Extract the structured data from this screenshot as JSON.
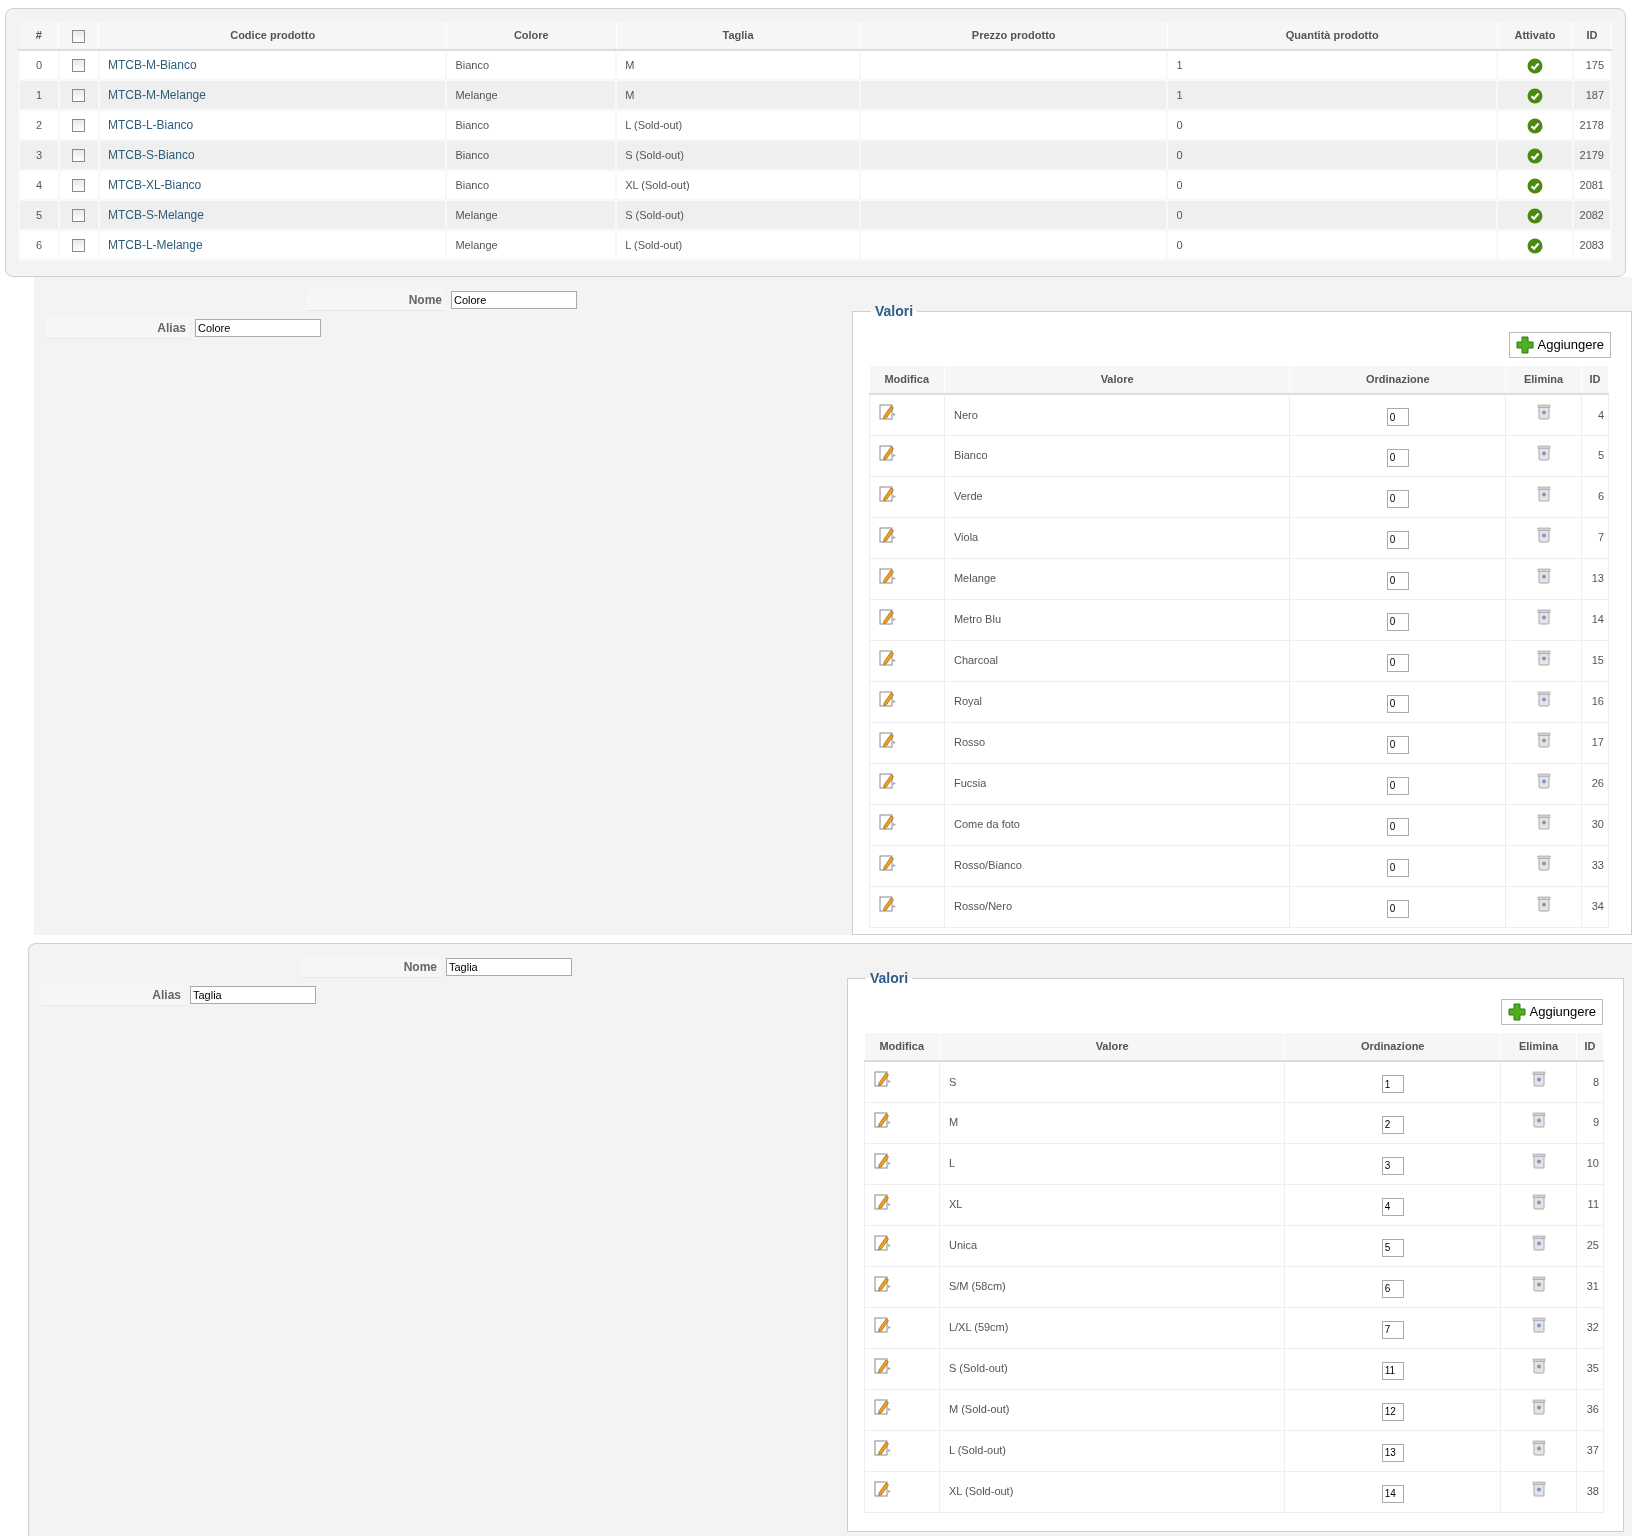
{
  "products": {
    "columns": [
      "#",
      "Codice prodotto",
      "Colore",
      "Taglia",
      "Prezzo prodotto",
      "Quantità prodotto",
      "Attivato",
      "ID"
    ],
    "select_all_checked": false,
    "rows": [
      {
        "index": "0",
        "checked": false,
        "code": "MTCB-M-Bianco",
        "colore": "Bianco",
        "size": "M",
        "qty": "1",
        "active": true,
        "id": "175"
      },
      {
        "index": "1",
        "checked": false,
        "code": "MTCB-M-Melange",
        "colore": "Melange",
        "size": "M",
        "qty": "1",
        "active": true,
        "id": "187"
      },
      {
        "index": "2",
        "checked": false,
        "code": "MTCB-L-Bianco",
        "colore": "Bianco",
        "size": "L (Sold-out)",
        "qty": "0",
        "active": true,
        "id": "2178"
      },
      {
        "index": "3",
        "checked": false,
        "code": "MTCB-S-Bianco",
        "colore": "Bianco",
        "size": "S (Sold-out)",
        "qty": "0",
        "active": true,
        "id": "2179"
      },
      {
        "index": "4",
        "checked": false,
        "code": "MTCB-XL-Bianco",
        "colore": "Bianco",
        "size": "XL (Sold-out)",
        "qty": "0",
        "active": true,
        "id": "2081"
      },
      {
        "index": "5",
        "checked": false,
        "code": "MTCB-S-Melange",
        "colore": "Melange",
        "size": "S (Sold-out)",
        "qty": "0",
        "active": true,
        "id": "2082"
      },
      {
        "index": "6",
        "checked": false,
        "code": "MTCB-L-Melange",
        "colore": "Melange",
        "size": "L (Sold-out)",
        "qty": "0",
        "active": true,
        "id": "2083"
      }
    ]
  },
  "attributes": [
    {
      "name_label": "Nome",
      "name": "Colore",
      "alias_label": "Alias",
      "alias": "Colore",
      "legend": "Valori",
      "add_button": "Aggiungere",
      "columns": [
        "Modifica",
        "Valore",
        "Ordinazione",
        "Elimina",
        "ID"
      ],
      "values": [
        {
          "value": "Nero",
          "order": "0",
          "id": "4"
        },
        {
          "value": "Bianco",
          "order": "0",
          "id": "5"
        },
        {
          "value": "Verde",
          "order": "0",
          "id": "6"
        },
        {
          "value": "Viola",
          "order": "0",
          "id": "7"
        },
        {
          "value": "Melange",
          "order": "0",
          "id": "13"
        },
        {
          "value": "Metro Blu",
          "order": "0",
          "id": "14"
        },
        {
          "value": "Charcoal",
          "order": "0",
          "id": "15"
        },
        {
          "value": "Royal",
          "order": "0",
          "id": "16"
        },
        {
          "value": "Rosso",
          "order": "0",
          "id": "17"
        },
        {
          "value": "Fucsia",
          "order": "0",
          "id": "26"
        },
        {
          "value": "Come da foto",
          "order": "0",
          "id": "30"
        },
        {
          "value": "Rosso/Bianco",
          "order": "0",
          "id": "33"
        },
        {
          "value": "Rosso/Nero",
          "order": "0",
          "id": "34"
        }
      ]
    },
    {
      "name_label": "Nome",
      "name": "Taglia",
      "alias_label": "Alias",
      "alias": "Taglia",
      "legend": "Valori",
      "add_button": "Aggiungere",
      "columns": [
        "Modifica",
        "Valore",
        "Ordinazione",
        "Elimina",
        "ID"
      ],
      "values": [
        {
          "value": "S",
          "order": "1",
          "id": "8"
        },
        {
          "value": "M",
          "order": "2",
          "id": "9"
        },
        {
          "value": "L",
          "order": "3",
          "id": "10"
        },
        {
          "value": "XL",
          "order": "4",
          "id": "11"
        },
        {
          "value": "Unica",
          "order": "5",
          "id": "25"
        },
        {
          "value": "S/M (58cm)",
          "order": "6",
          "id": "31"
        },
        {
          "value": "L/XL (59cm)",
          "order": "7",
          "id": "32"
        },
        {
          "value": "S (Sold-out)",
          "order": "11",
          "id": "35"
        },
        {
          "value": "M (Sold-out)",
          "order": "12",
          "id": "36"
        },
        {
          "value": "L (Sold-out)",
          "order": "13",
          "id": "37"
        },
        {
          "value": "XL (Sold-out)",
          "order": "14",
          "id": "38"
        }
      ]
    }
  ]
}
